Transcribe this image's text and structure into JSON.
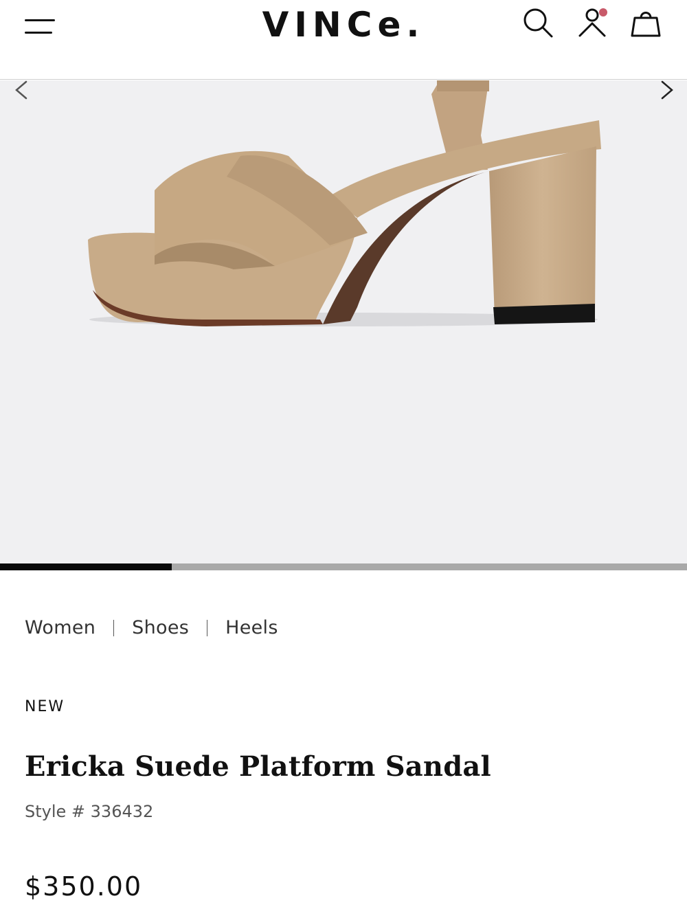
{
  "header": {
    "brand": "VINCe.",
    "menu_icon": "hamburger-menu-icon",
    "search_icon": "search-icon",
    "account_icon": "user-icon",
    "bag_icon": "shopping-bag-icon",
    "notification_color": "#c85a6a"
  },
  "gallery": {
    "image": "product-image-sandal",
    "prev_icon": "chevron-left-icon",
    "next_icon": "chevron-right-icon",
    "progress_fraction": 0.25,
    "background": "#f0f0f2"
  },
  "breadcrumb": [
    "Women",
    "Shoes",
    "Heels"
  ],
  "product": {
    "badge": "NEW",
    "name": "Ericka Suede Platform Sandal",
    "style": "Style # 336432",
    "price": "$350.00",
    "suede_color": "#c8ab88"
  }
}
